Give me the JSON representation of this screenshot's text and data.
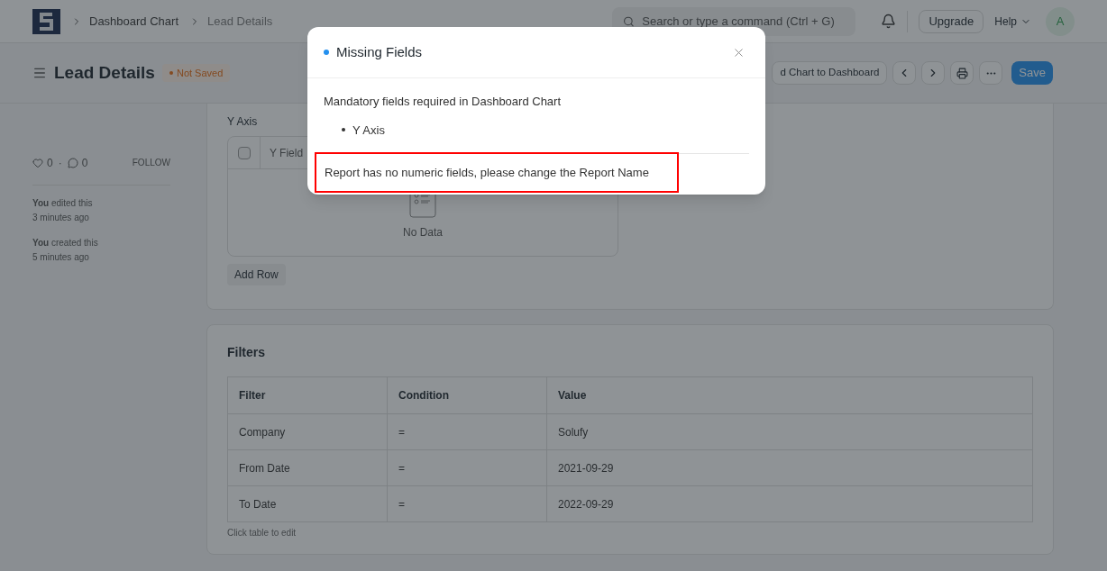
{
  "navbar": {
    "breadcrumbs": [
      "Dashboard Chart",
      "Lead Details"
    ],
    "search": {
      "placeholder": "Search or type a command (Ctrl + G)"
    },
    "upgrade": "Upgrade",
    "help": "Help",
    "avatar": "A"
  },
  "page_head": {
    "title": "Lead Details",
    "status": "Not Saved",
    "actions": [
      "d Chart to Dashboard"
    ],
    "save": "Save"
  },
  "sidebar": {
    "likes": "0",
    "separator": "·",
    "comments": "0",
    "follow": "FOLLOW",
    "timeline": [
      {
        "who": "You",
        "what": "edited this",
        "when": "3 minutes ago"
      },
      {
        "who": "You",
        "what": "created this",
        "when": "5 minutes ago"
      }
    ]
  },
  "y_axis": {
    "label": "Y Axis",
    "select_all": {
      "checked": false
    },
    "columns": [
      "Y Field"
    ],
    "empty": "No Data",
    "add_row": "Add Row"
  },
  "filters": {
    "title": "Filters",
    "columns": [
      "Filter",
      "Condition",
      "Value"
    ],
    "rows": [
      [
        "Company",
        "=",
        "Solufy"
      ],
      [
        "From Date",
        "=",
        "2021-09-29"
      ],
      [
        "To Date",
        "=",
        "2022-09-29"
      ]
    ],
    "hint": "Click table to edit"
  },
  "modal": {
    "title": "Missing Fields",
    "intro": "Mandatory fields required in Dashboard Chart",
    "missing": [
      "Y Axis"
    ],
    "message": "Report has no numeric fields, please change the Report Name"
  }
}
